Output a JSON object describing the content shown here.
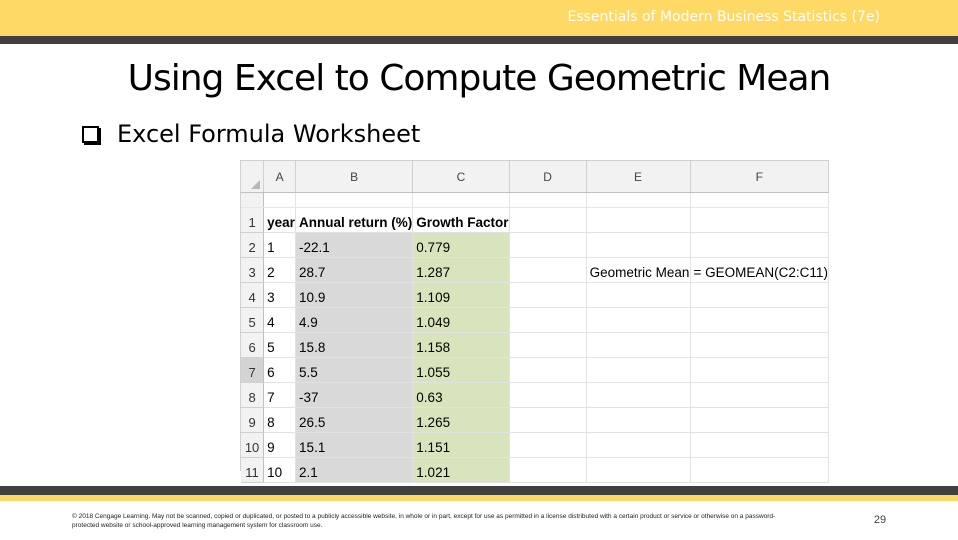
{
  "header": {
    "course_title": "Essentials of Modern Business Statistics (7e)"
  },
  "slide": {
    "title": "Using Excel to Compute Geometric Mean",
    "bullet": "Excel Formula Worksheet"
  },
  "spreadsheet": {
    "columns": [
      "A",
      "B",
      "C",
      "D",
      "E",
      "F"
    ],
    "row_numbers": [
      "1",
      "2",
      "3",
      "4",
      "5",
      "6",
      "7",
      "8",
      "9",
      "10",
      "11"
    ],
    "headers": {
      "A": "year",
      "B": "Annual return (%)",
      "C": "Growth Factor"
    },
    "rows": [
      {
        "A": "1",
        "B": "-22.1",
        "C": "0.779",
        "E": "",
        "F": ""
      },
      {
        "A": "2",
        "B": "28.7",
        "C": "1.287",
        "E": "Geometric Mean",
        "F": "= GEOMEAN(C2:C11)"
      },
      {
        "A": "3",
        "B": "10.9",
        "C": "1.109",
        "E": "",
        "F": ""
      },
      {
        "A": "4",
        "B": "4.9",
        "C": "1.049",
        "E": "",
        "F": ""
      },
      {
        "A": "5",
        "B": "15.8",
        "C": "1.158",
        "E": "",
        "F": ""
      },
      {
        "A": "6",
        "B": "5.5",
        "C": "1.055",
        "E": "",
        "F": ""
      },
      {
        "A": "7",
        "B": "-37",
        "C": "0.63",
        "E": "",
        "F": ""
      },
      {
        "A": "8",
        "B": "26.5",
        "C": "1.265",
        "E": "",
        "F": ""
      },
      {
        "A": "9",
        "B": "15.1",
        "C": "1.151",
        "E": "",
        "F": ""
      },
      {
        "A": "10",
        "B": "2.1",
        "C": "1.021",
        "E": "",
        "F": ""
      }
    ],
    "selected_row": "7",
    "colors": {
      "column_b_fill": "#d9d9d9",
      "column_c_fill": "#d8e4bc"
    }
  },
  "footer": {
    "copyright": "© 2018 Cengage Learning. May not be scanned, copied or duplicated, or posted to a publicly accessible website, in whole or in part, except for use as permitted in a license distributed with a certain product or service or otherwise on a password-protected website or school-approved learning management system for classroom use.",
    "page_number": "29"
  },
  "theme": {
    "accent_yellow": "#ffd966",
    "rule_gray": "#404040"
  }
}
